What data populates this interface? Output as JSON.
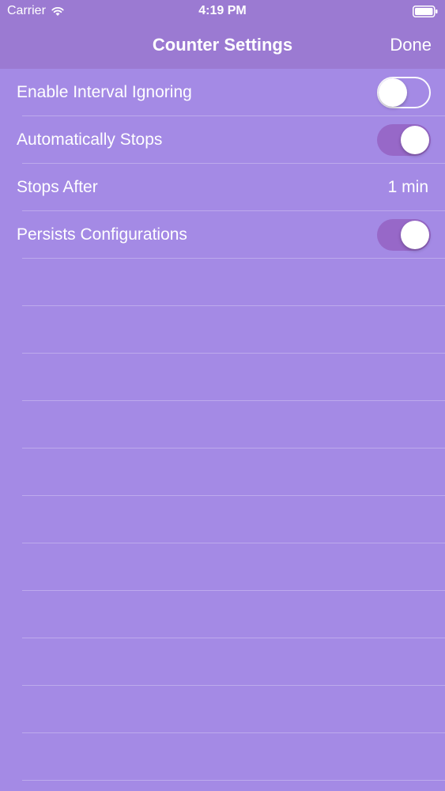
{
  "status_bar": {
    "carrier": "Carrier",
    "time": "4:19 PM"
  },
  "nav": {
    "title": "Counter Settings",
    "done_label": "Done"
  },
  "settings": [
    {
      "label": "Enable Interval Ignoring",
      "type": "toggle",
      "on": false
    },
    {
      "label": "Automatically Stops",
      "type": "toggle",
      "on": true
    },
    {
      "label": "Stops After",
      "type": "value",
      "value": "1 min"
    },
    {
      "label": "Persists Configurations",
      "type": "toggle",
      "on": true
    }
  ],
  "colors": {
    "background": "#a48ae5",
    "nav_bar": "#9b7ad2",
    "toggle_on": "#9768c8"
  }
}
